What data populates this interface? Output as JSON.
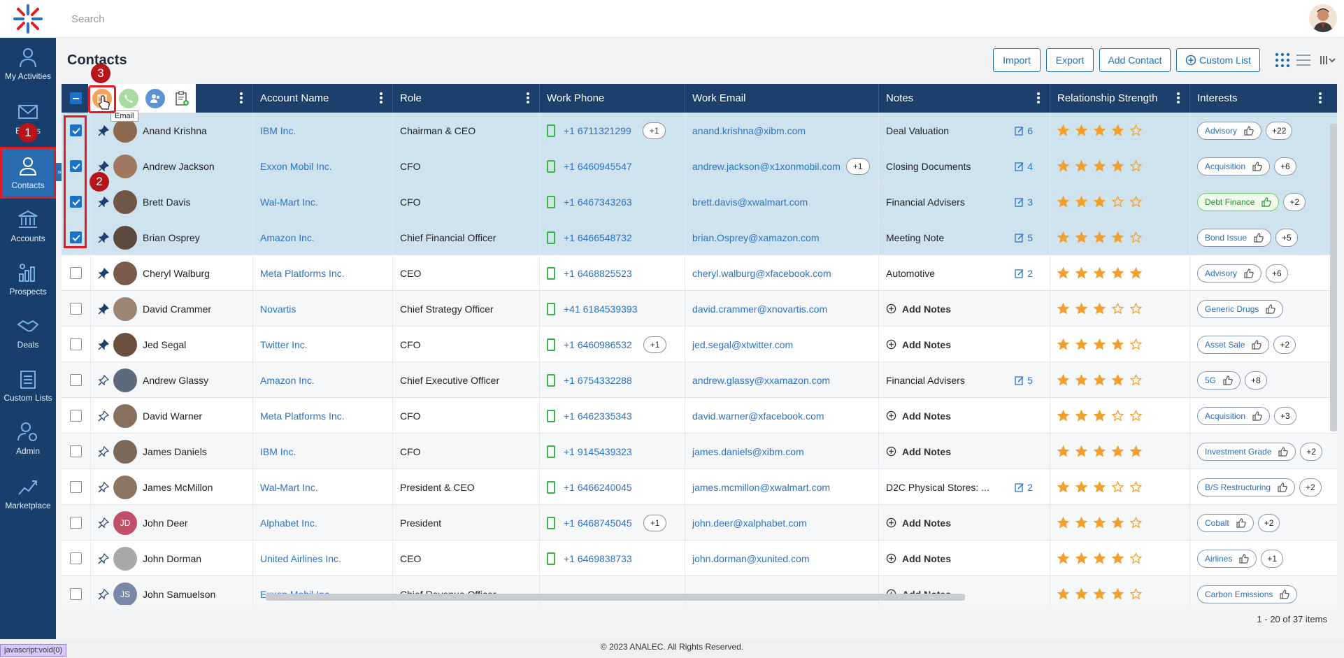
{
  "app": {
    "search_placeholder": "Search"
  },
  "sidebar": {
    "items": [
      {
        "label": "My Activities",
        "icon": "person-activity-icon"
      },
      {
        "label": "Emails",
        "icon": "envelope-icon"
      },
      {
        "label": "Contacts",
        "icon": "person-icon",
        "active": true
      },
      {
        "label": "Accounts",
        "icon": "bank-icon"
      },
      {
        "label": "Prospects",
        "icon": "chart-icon"
      },
      {
        "label": "Deals",
        "icon": "handshake-icon"
      },
      {
        "label": "Custom Lists",
        "icon": "clipboard-list-icon"
      },
      {
        "label": "Admin",
        "icon": "user-gear-icon"
      },
      {
        "label": "Marketplace",
        "icon": "growth-chart-icon"
      }
    ]
  },
  "page": {
    "title": "Contacts",
    "buttons": {
      "import": "Import",
      "export": "Export",
      "add_contact": "Add Contact",
      "custom_list": "Custom List"
    }
  },
  "toolbar": {
    "tooltip": "Email"
  },
  "badges": {
    "b1": "1",
    "b2": "2",
    "b3": "3"
  },
  "columns": {
    "account": "Account Name",
    "role": "Role",
    "phone": "Work Phone",
    "email": "Work Email",
    "notes": "Notes",
    "strength": "Relationship Strength",
    "interests": "Interests"
  },
  "rows": [
    {
      "name": "Anand Krishna",
      "account": "IBM Inc.",
      "role": "Chairman & CEO",
      "phone": "+1 6711321299",
      "phone_extra": "+1",
      "email": "anand.krishna@xibm.com",
      "email_extra": "",
      "note": "Deal Valuation",
      "note_count": "6",
      "stars": 4,
      "tag": "Advisory",
      "tag_green": false,
      "tag_extra": "+22",
      "checked": true,
      "pinned": true
    },
    {
      "name": "Andrew Jackson",
      "account": "Exxon Mobil Inc.",
      "role": "CFO",
      "phone": "+1 6460945547",
      "phone_extra": "",
      "email": "andrew.jackson@x1xonmobil.com",
      "email_extra": "+1",
      "note": "Closing Documents",
      "note_count": "4",
      "stars": 4,
      "tag": "Acquisition",
      "tag_green": false,
      "tag_extra": "+6",
      "checked": true,
      "pinned": true
    },
    {
      "name": "Brett Davis",
      "account": "Wal-Mart Inc.",
      "role": "CFO",
      "phone": "+1 6467343263",
      "phone_extra": "",
      "email": "brett.davis@xwalmart.com",
      "email_extra": "",
      "note": "Financial Advisers",
      "note_count": "3",
      "stars": 3,
      "tag": "Debt Finance",
      "tag_green": true,
      "tag_extra": "+2",
      "checked": true,
      "pinned": true
    },
    {
      "name": "Brian Osprey",
      "account": "Amazon Inc.",
      "role": "Chief Financial Officer",
      "phone": "+1 6466548732",
      "phone_extra": "",
      "email": "brian.Osprey@xamazon.com",
      "email_extra": "",
      "note": "Meeting Note",
      "note_count": "5",
      "stars": 4,
      "tag": "Bond Issue",
      "tag_green": false,
      "tag_extra": "+5",
      "checked": true,
      "pinned": true
    },
    {
      "name": "Cheryl Walburg",
      "account": "Meta Platforms Inc.",
      "role": "CEO",
      "phone": "+1 6468825523",
      "phone_extra": "",
      "email": "cheryl.walburg@xfacebook.com",
      "email_extra": "",
      "note": "Automotive",
      "note_count": "2",
      "stars": 5,
      "tag": "Advisory",
      "tag_green": false,
      "tag_extra": "+6",
      "checked": false,
      "pinned": true
    },
    {
      "name": "David Crammer",
      "account": "Novartis",
      "role": "Chief Strategy Officer",
      "phone": "+41 6184539393",
      "phone_extra": "",
      "email": "david.crammer@xnovartis.com",
      "email_extra": "",
      "note": "",
      "note_count": "",
      "stars": 3,
      "tag": "Generic Drugs",
      "tag_green": false,
      "tag_extra": "",
      "checked": false,
      "pinned": true
    },
    {
      "name": "Jed Segal",
      "account": "Twitter Inc.",
      "role": "CFO",
      "phone": "+1 6460986532",
      "phone_extra": "+1",
      "email": "jed.segal@xtwitter.com",
      "email_extra": "",
      "note": "",
      "note_count": "",
      "stars": 4,
      "tag": "Asset Sale",
      "tag_green": false,
      "tag_extra": "+2",
      "checked": false,
      "pinned": true
    },
    {
      "name": "Andrew Glassy",
      "account": "Amazon Inc.",
      "role": "Chief Executive Officer",
      "phone": "+1 6754332288",
      "phone_extra": "",
      "email": "andrew.glassy@xxamazon.com",
      "email_extra": "",
      "note": "Financial Advisers",
      "note_count": "5",
      "stars": 4,
      "tag": "5G",
      "tag_green": false,
      "tag_extra": "+8",
      "checked": false,
      "pinned": false
    },
    {
      "name": "David Warner",
      "account": "Meta Platforms Inc.",
      "role": "CFO",
      "phone": "+1 6462335343",
      "phone_extra": "",
      "email": "david.warner@xfacebook.com",
      "email_extra": "",
      "note": "",
      "note_count": "",
      "stars": 3,
      "tag": "Acquisition",
      "tag_green": false,
      "tag_extra": "+3",
      "checked": false,
      "pinned": false
    },
    {
      "name": "James Daniels",
      "account": "IBM Inc.",
      "role": "CFO",
      "phone": "+1 9145439323",
      "phone_extra": "",
      "email": "james.daniels@xibm.com",
      "email_extra": "",
      "note": "",
      "note_count": "",
      "stars": 5,
      "tag": "Investment Grade",
      "tag_green": false,
      "tag_extra": "+2",
      "checked": false,
      "pinned": false
    },
    {
      "name": "James McMillon",
      "account": "Wal-Mart Inc.",
      "role": "President & CEO",
      "phone": "+1 6466240045",
      "phone_extra": "",
      "email": "james.mcmillon@xwalmart.com",
      "email_extra": "",
      "note": "D2C Physical Stores: ...",
      "note_count": "2",
      "stars": 3,
      "tag": "B/S Restructuring",
      "tag_green": false,
      "tag_extra": "+2",
      "checked": false,
      "pinned": false
    },
    {
      "name": "John Deer",
      "account": "Alphabet Inc.",
      "role": "President",
      "phone": "+1 6468745045",
      "phone_extra": "+1",
      "email": "john.deer@xalphabet.com",
      "email_extra": "",
      "note": "",
      "note_count": "",
      "stars": 4,
      "tag": "Cobalt",
      "tag_green": false,
      "tag_extra": "+2",
      "checked": false,
      "pinned": false,
      "initials": "JD"
    },
    {
      "name": "John Dorman",
      "account": "United Airlines Inc.",
      "role": "CEO",
      "phone": "+1 6469838733",
      "phone_extra": "",
      "email": "john.dorman@xunited.com",
      "email_extra": "",
      "note": "",
      "note_count": "",
      "stars": 4,
      "tag": "Airlines",
      "tag_green": false,
      "tag_extra": "+1",
      "checked": false,
      "pinned": false
    },
    {
      "name": "John Samuelson",
      "account": "Exxon Mobil Inc.",
      "role": "Chief Revenue Officer",
      "phone": "",
      "phone_extra": "",
      "email": "",
      "email_extra": "",
      "note": "",
      "note_count": "",
      "stars": 4,
      "tag": "Carbon Emissions",
      "tag_green": false,
      "tag_extra": "",
      "checked": false,
      "pinned": false,
      "initials": "JS"
    }
  ],
  "add_notes_label": "Add Notes",
  "pager": "1 - 20 of 37 items",
  "copyright": "© 2023 ANALEC. All Rights Reserved.",
  "status_tip": "javascript:void(0)",
  "colors": {
    "nav": "#183f6b",
    "header": "#1d3f6c",
    "accent": "#1f6fb3",
    "star": "#f0a030",
    "selected_row": "#cfe3ee",
    "highlight": "#e31b23"
  }
}
